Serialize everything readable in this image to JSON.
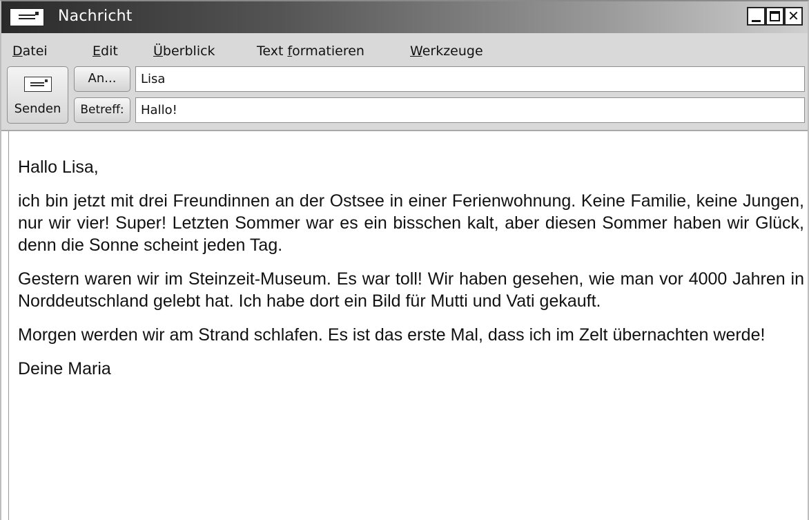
{
  "window": {
    "title": "Nachricht"
  },
  "menu": [
    {
      "label": "Datei",
      "mnemonic": "D",
      "rest": "atei"
    },
    {
      "label": "Edit",
      "mnemonic": "E",
      "rest": "dit"
    },
    {
      "label": "Überblick",
      "mnemonic": "Ü",
      "rest": "berblick"
    },
    {
      "label": "Text formatieren",
      "prefix": "Text ",
      "mnemonic": "f",
      "rest": "ormatieren"
    },
    {
      "label": "Werkzeuge",
      "mnemonic": "W",
      "rest": "erkzeuge"
    }
  ],
  "toolbar": {
    "send_label": "Senden",
    "to_label": "An...",
    "subject_label": "Betreff:",
    "to_value": "Lisa",
    "subject_value": "Hallo!"
  },
  "message": {
    "paragraphs": [
      "Hallo Lisa,",
      "ich bin jetzt mit drei Freundinnen an der Ostsee in einer Ferienwohnung. Keine Familie, keine Jungen, nur wir vier! Super! Letzten Sommer war es ein bisschen kalt, aber diesen Sommer haben wir Glück, denn die Sonne scheint jeden Tag.",
      "Gestern waren wir im Steinzeit-Museum. Es war toll! Wir haben gesehen, wie man vor 4000 Jahren in Norddeutschland gelebt hat. Ich habe dort ein Bild für Mutti und Vati gekauft.",
      "Morgen werden wir am Strand schlafen. Es ist das erste Mal, dass ich im Zelt übernachten werde!",
      "Deine Maria"
    ]
  },
  "icons": {
    "app": "envelope-icon",
    "send": "envelope-icon",
    "minimize": "minimize-icon",
    "maximize": "maximize-icon",
    "close": "close-icon"
  }
}
